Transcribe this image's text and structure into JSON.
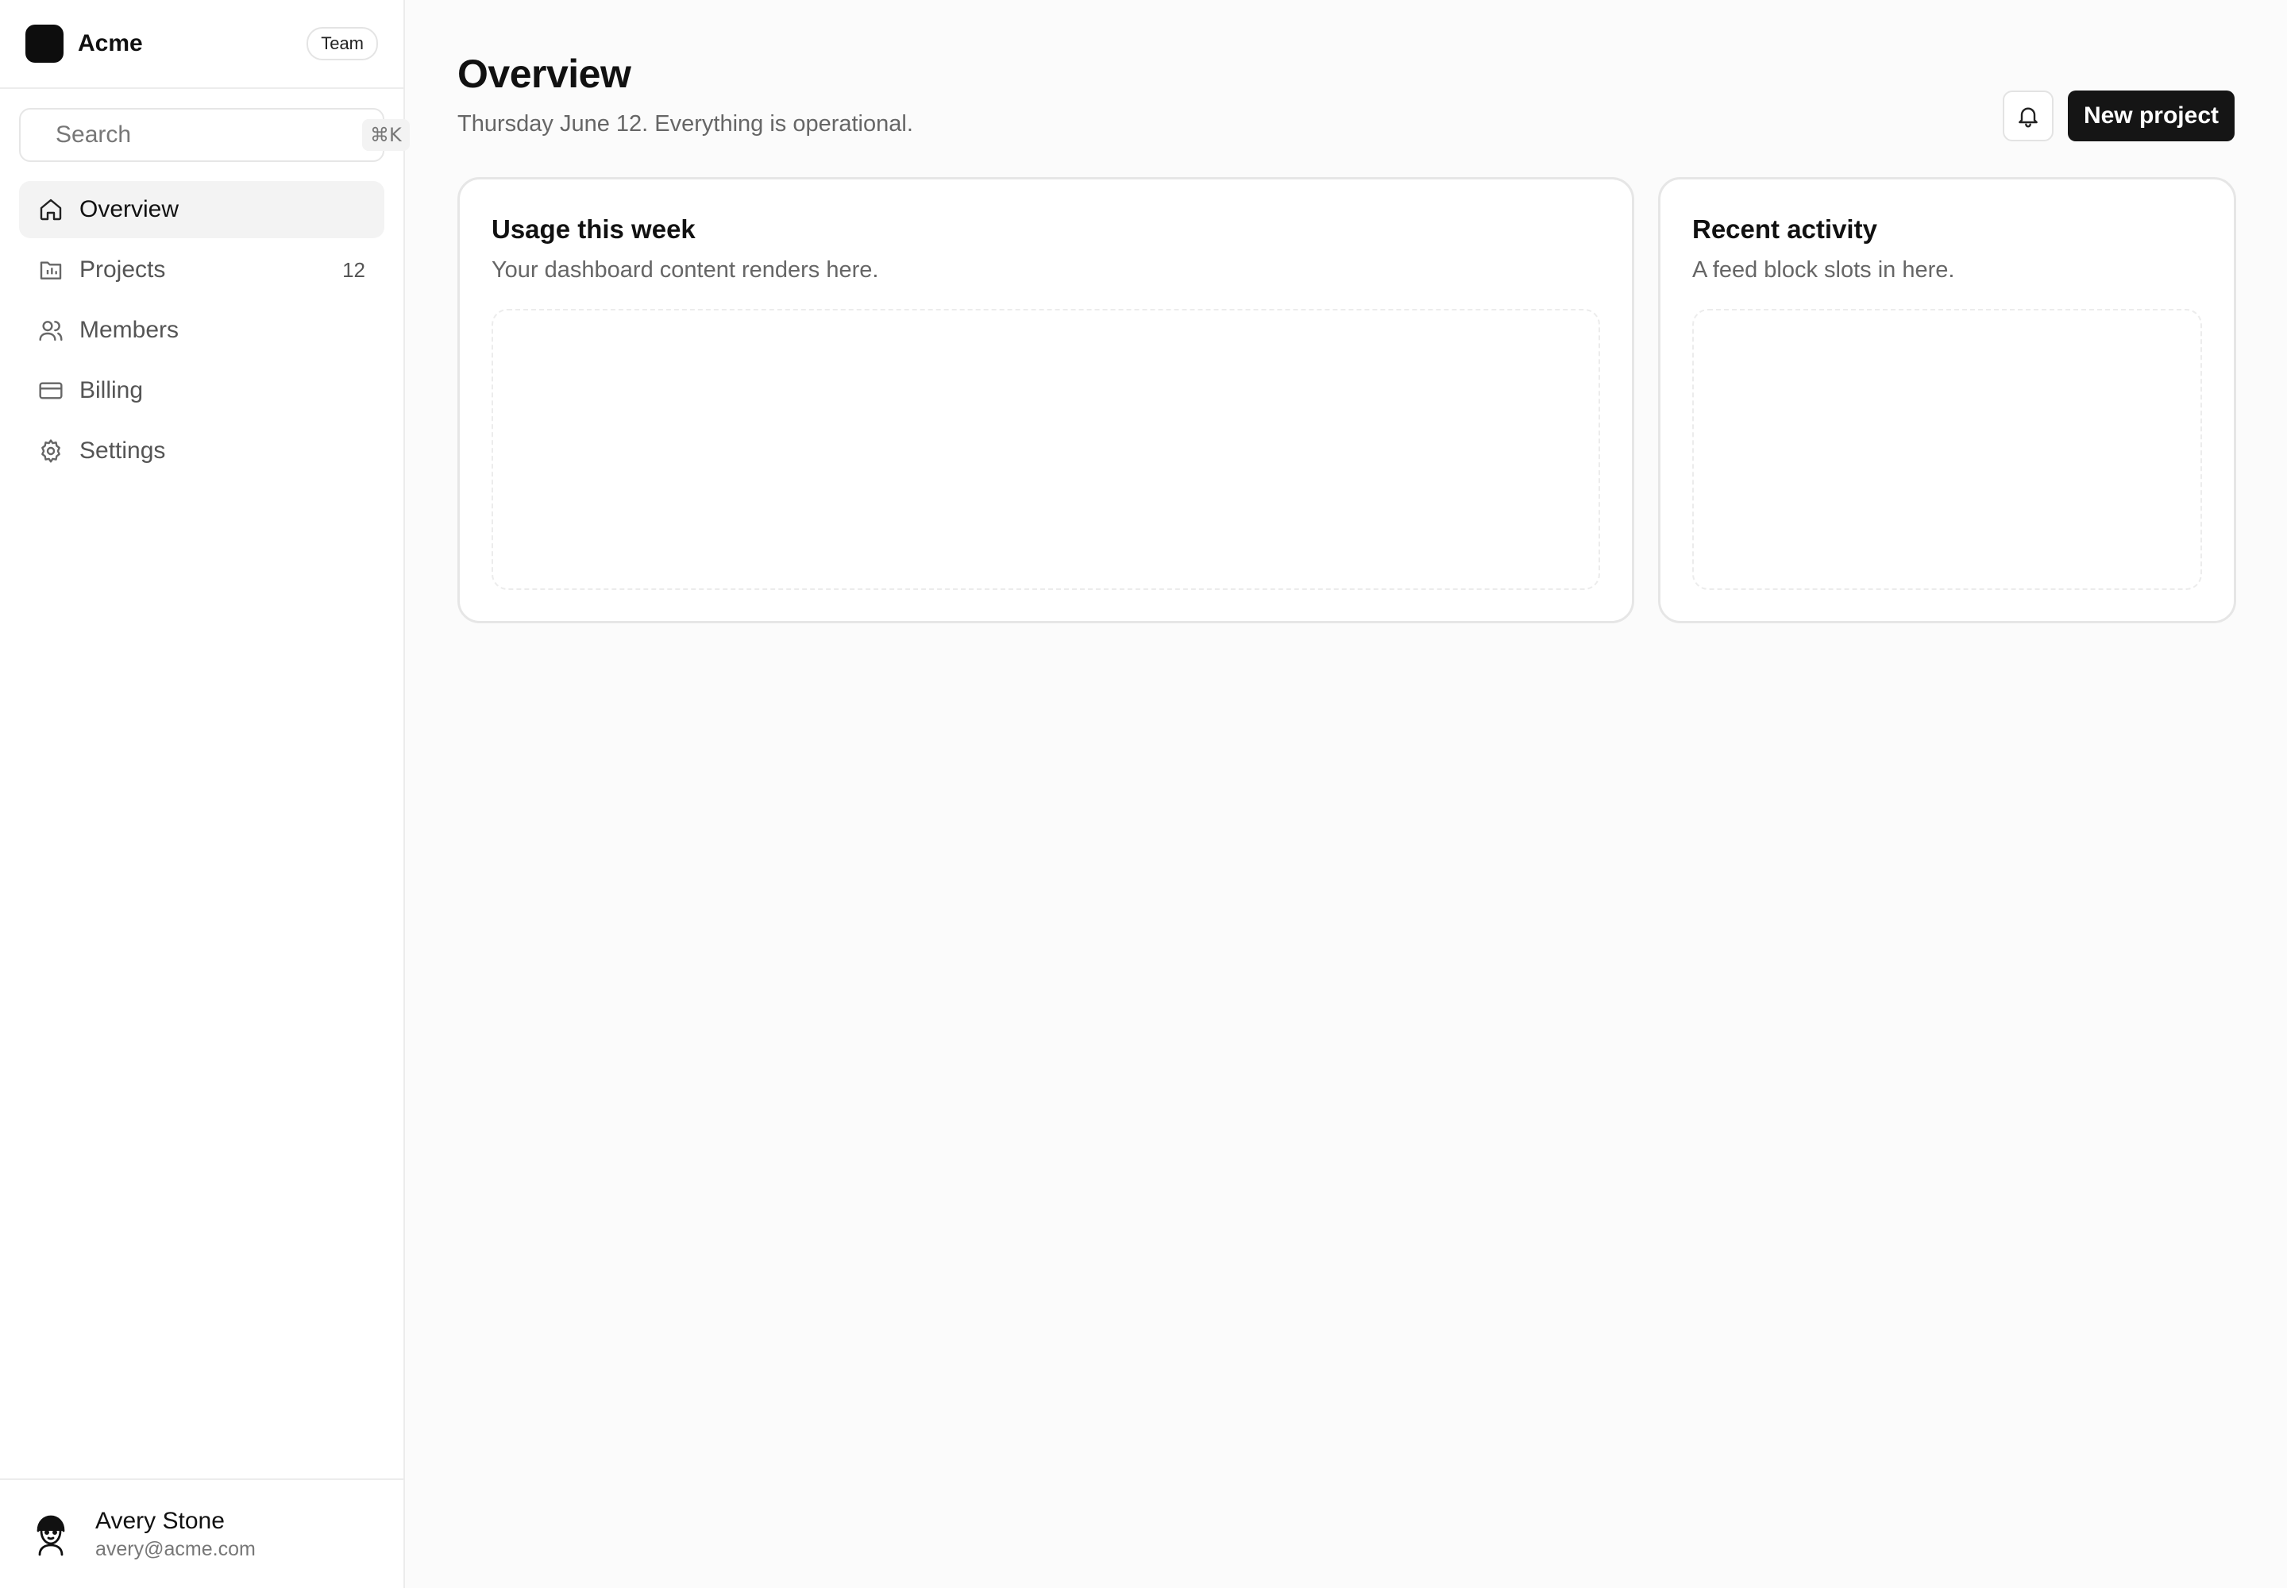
{
  "brand": {
    "name": "Acme",
    "badge": "Team"
  },
  "search": {
    "placeholder": "Search",
    "shortcut": "⌘K"
  },
  "sidebar": {
    "items": [
      {
        "label": "Overview",
        "icon": "home-icon",
        "active": true
      },
      {
        "label": "Projects",
        "icon": "folder-chart-icon",
        "count": "12"
      },
      {
        "label": "Members",
        "icon": "users-icon"
      },
      {
        "label": "Billing",
        "icon": "credit-card-icon"
      },
      {
        "label": "Settings",
        "icon": "gear-icon"
      }
    ]
  },
  "user": {
    "name": "Avery Stone",
    "email": "avery@acme.com"
  },
  "header": {
    "title": "Overview",
    "subtitle": "Thursday June 12. Everything is operational.",
    "new_project_label": "New project"
  },
  "cards": [
    {
      "title": "Usage this week",
      "subtitle": "Your dashboard content renders here."
    },
    {
      "title": "Recent activity",
      "subtitle": "A feed block slots in here."
    }
  ]
}
